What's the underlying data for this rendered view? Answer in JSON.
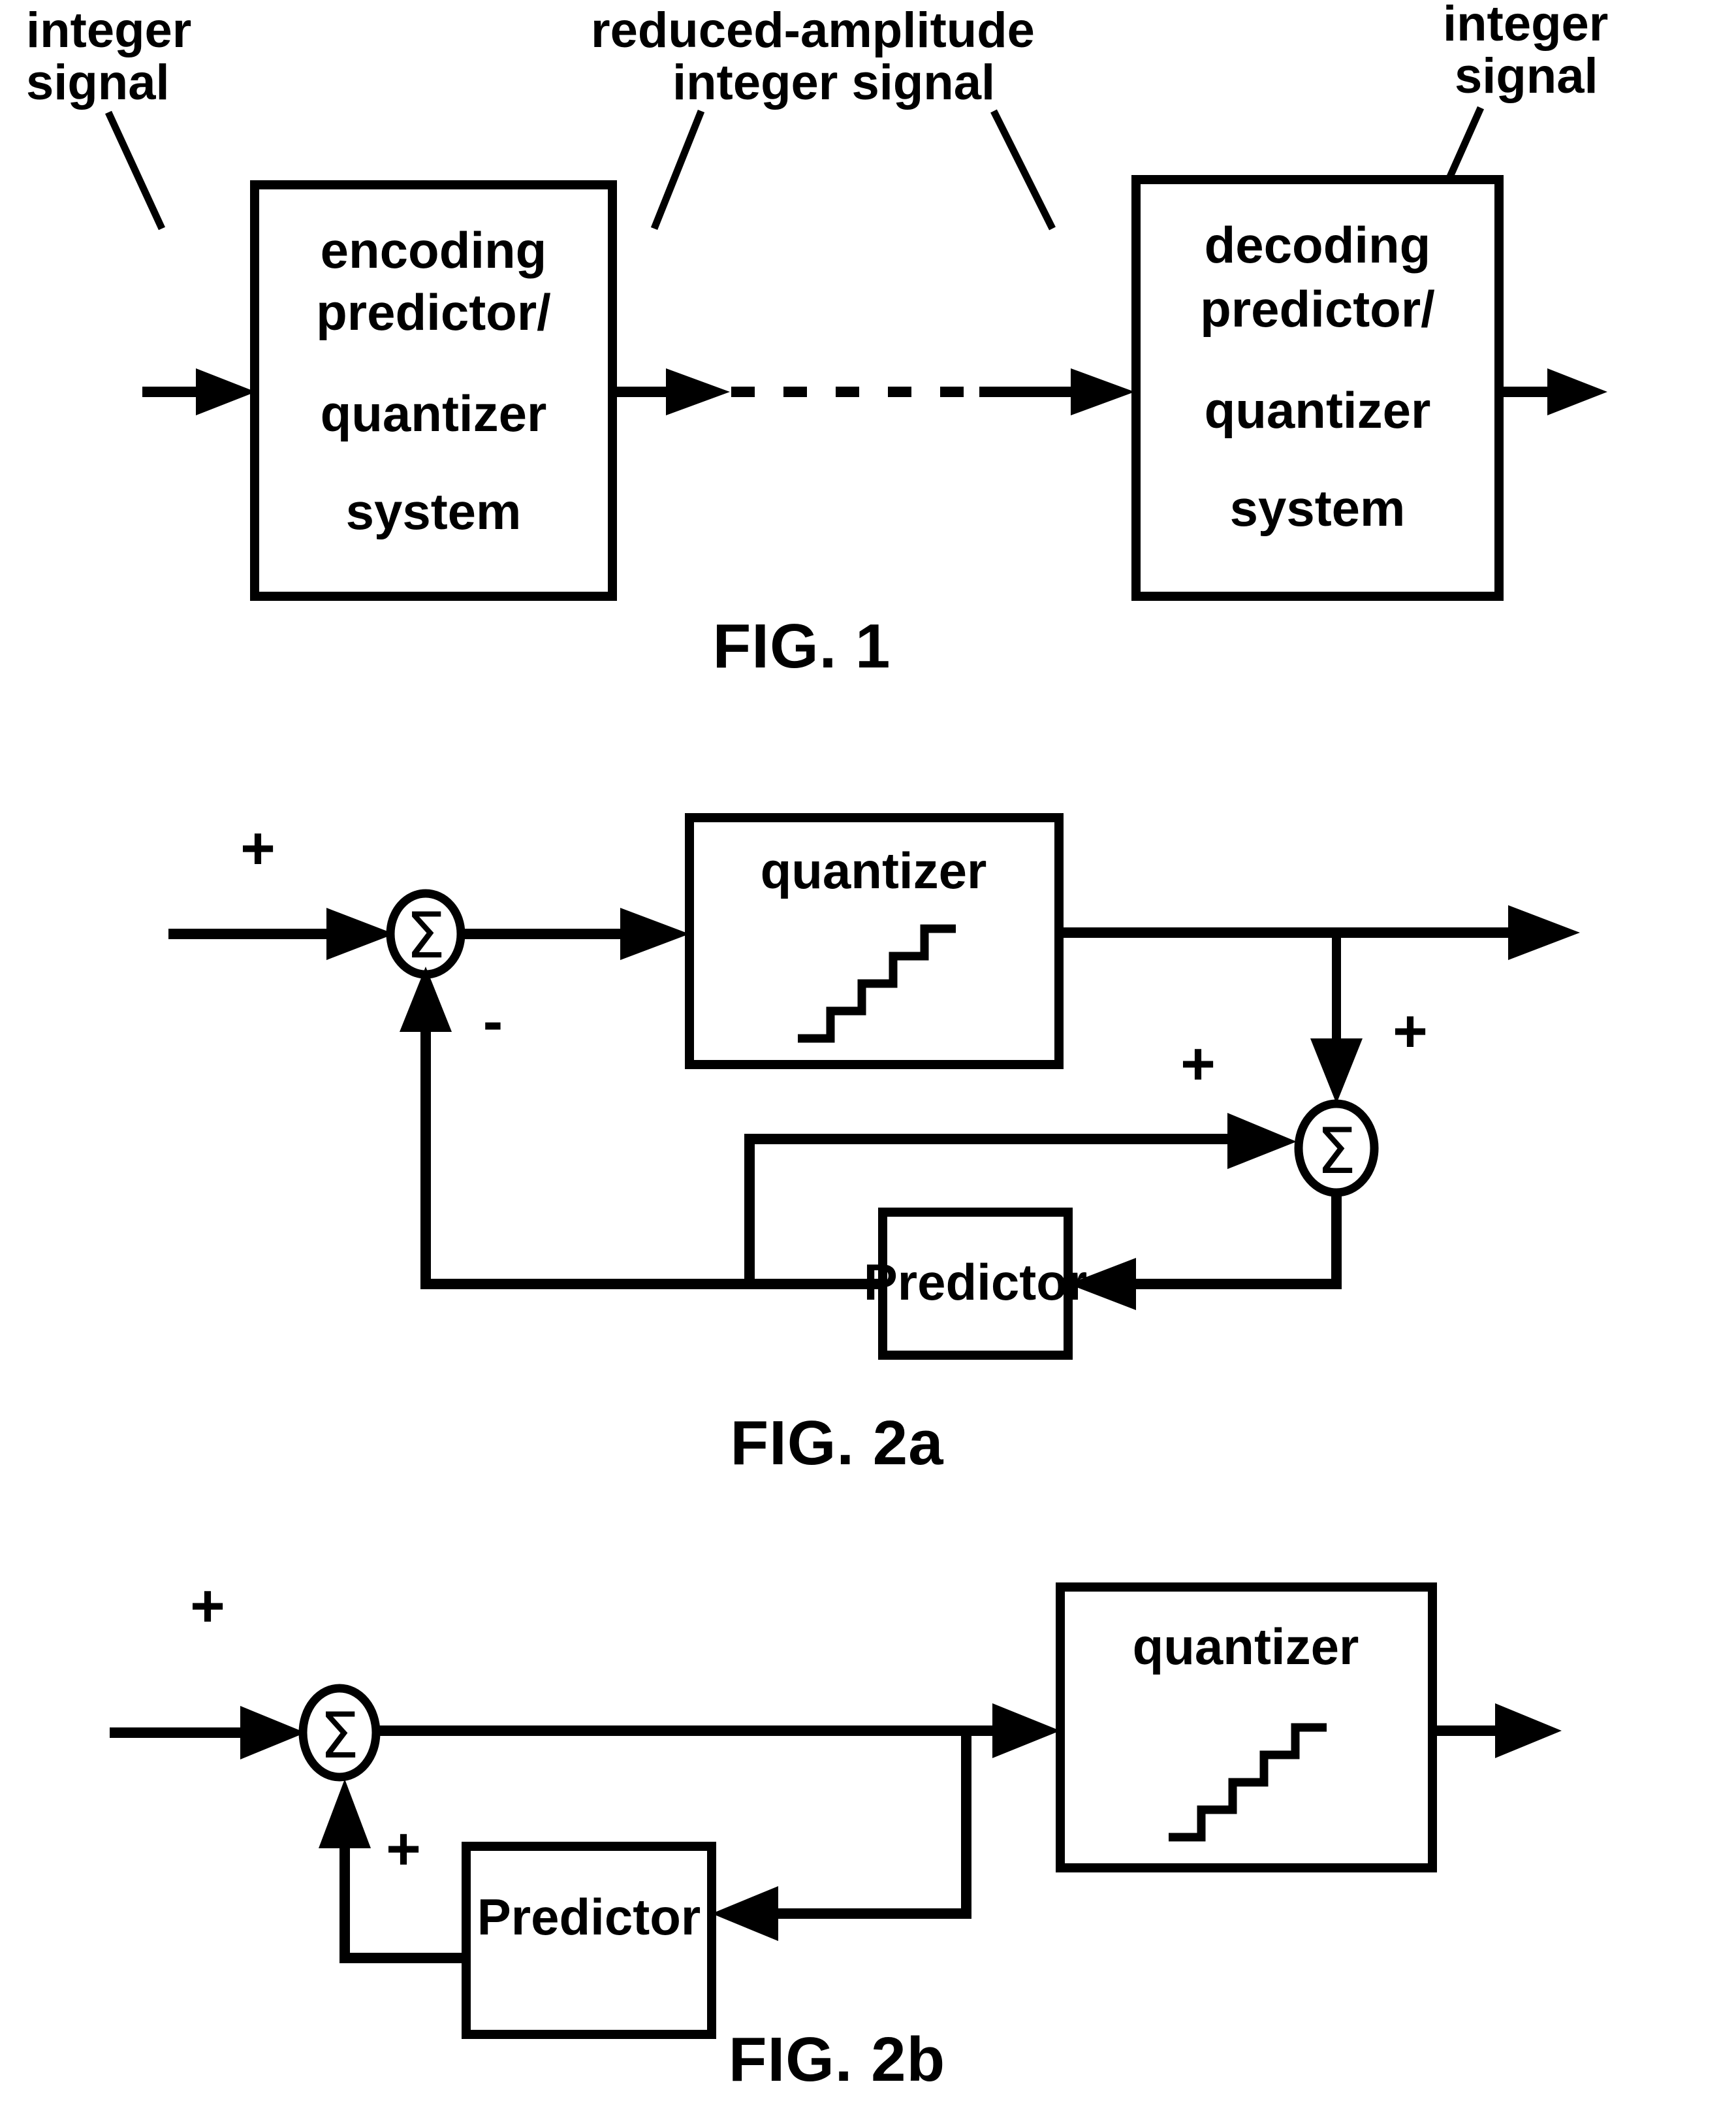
{
  "document": {
    "type": "patent-drawing-sheet",
    "background_color": "#ffffff",
    "ink_color": "#000000"
  },
  "figures": [
    {
      "id": "fig1",
      "caption": "FIG. 1",
      "labels": [
        {
          "id": "lbl-integer-signal-in",
          "lines": [
            "integer",
            "signal"
          ]
        },
        {
          "id": "lbl-reduced-amplitude",
          "lines": [
            "reduced-amplitude",
            "integer signal"
          ]
        },
        {
          "id": "lbl-integer-signal-out",
          "lines": [
            "integer",
            "signal"
          ]
        }
      ],
      "blocks": [
        {
          "id": "encoder-block",
          "lines": [
            "encoding",
            "predictor/",
            "quantizer",
            "system"
          ]
        },
        {
          "id": "decoder-block",
          "lines": [
            "decoding",
            "predictor/",
            "quantizer",
            "system"
          ]
        }
      ],
      "connections": [
        {
          "id": "input-arrow",
          "style": "solid-arrow"
        },
        {
          "id": "channel-link",
          "style": "dashed"
        },
        {
          "id": "output-arrow",
          "style": "solid-arrow"
        }
      ]
    },
    {
      "id": "fig2a",
      "caption": "FIG. 2a",
      "blocks": [
        {
          "id": "quantizer-block-2a",
          "label": "quantizer",
          "icon": "staircase-icon",
          "staircase_steps": 5
        },
        {
          "id": "predictor-block-2a",
          "label": "Predictor"
        }
      ],
      "summers": [
        {
          "id": "summer-1-2a",
          "glyph": "Σ",
          "input_signs": [
            "+",
            "-"
          ]
        },
        {
          "id": "summer-2-2a",
          "glyph": "Σ",
          "input_signs": [
            "+",
            "+"
          ]
        }
      ],
      "signs": {
        "s1_top_plus": "+",
        "s1_minus": "-",
        "s2_left_plus": "+",
        "s2_top_plus": "+"
      }
    },
    {
      "id": "fig2b",
      "caption": "FIG. 2b",
      "blocks": [
        {
          "id": "quantizer-block-2b",
          "label": "quantizer",
          "icon": "staircase-icon",
          "staircase_steps": 5
        },
        {
          "id": "predictor-block-2b",
          "label": "Predictor"
        }
      ],
      "summers": [
        {
          "id": "summer-1-2b",
          "glyph": "Σ",
          "input_signs": [
            "+",
            "+"
          ]
        }
      ],
      "signs": {
        "s1_top_plus": "+",
        "s1_bottom_plus": "+"
      }
    }
  ],
  "fig1": {
    "caption": "FIG. 1",
    "label_in_line1": "integer",
    "label_in_line2": "signal",
    "label_mid_line1": "reduced-amplitude",
    "label_mid_line2": "integer signal",
    "label_out_line1": "integer",
    "label_out_line2": "signal",
    "enc_l1": "encoding",
    "enc_l2": "predictor/",
    "enc_l3": "quantizer",
    "enc_l4": "system",
    "dec_l1": "decoding",
    "dec_l2": "predictor/",
    "dec_l3": "quantizer",
    "dec_l4": "system"
  },
  "fig2a": {
    "caption": "FIG. 2a",
    "quantizer_label": "quantizer",
    "predictor_label": "Predictor",
    "sigma": "Σ",
    "plus_in": "+",
    "minus_fb": "-",
    "plus_pred": "+",
    "plus_tap": "+"
  },
  "fig2b": {
    "caption": "FIG. 2b",
    "quantizer_label": "quantizer",
    "predictor_label": "Predictor",
    "sigma": "Σ",
    "plus_in": "+",
    "plus_fb": "+"
  }
}
